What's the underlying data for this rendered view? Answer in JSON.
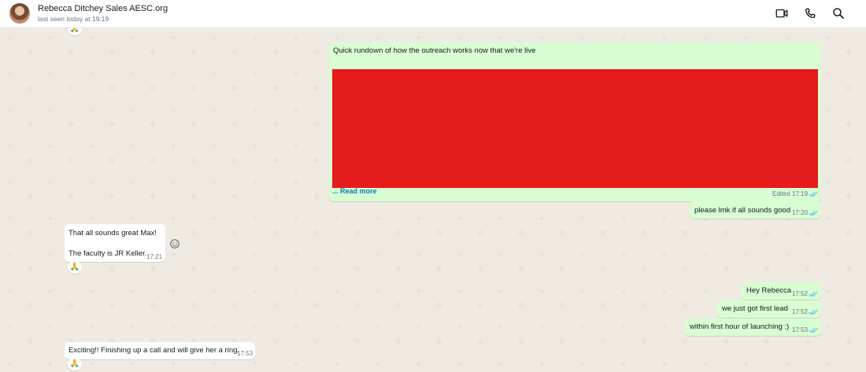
{
  "header": {
    "contact_name": "Rebecca Ditchey Sales AESC.org",
    "last_seen": "last seen today at 19:19",
    "icons": [
      "video-call-icon",
      "voice-call-icon",
      "search-icon"
    ]
  },
  "colors": {
    "outgoing_bubble": "#d9fdd3",
    "incoming_bubble": "#ffffff",
    "chat_background": "#efeae2",
    "read_ticks": "#53bdeb",
    "redaction": "#e51c1c"
  },
  "messages": [
    {
      "text": "Quick rundown of how the outreach works now that we're live",
      "read_more": "... Read more",
      "edited": "Edited",
      "time": "17:19",
      "direction": "outgoing",
      "status": "read"
    },
    {
      "text": "please lmk if all sounds good",
      "time": "17:20",
      "direction": "outgoing",
      "status": "read"
    },
    {
      "line1": "That all sounds great Max!",
      "line2": "The faculty is JR Keller.",
      "time": "17:21",
      "direction": "incoming",
      "reaction": "🙏"
    },
    {
      "text": "Hey Rebecca",
      "time": "17:52",
      "direction": "outgoing",
      "status": "read"
    },
    {
      "text": "we just got first lead",
      "time": "17:52",
      "direction": "outgoing",
      "status": "read"
    },
    {
      "text": "within first hour of launching :)",
      "time": "17:53",
      "direction": "outgoing",
      "status": "read"
    },
    {
      "text": "Exciting!! Finishing up a call and will give her a ring.",
      "time": "17:53",
      "direction": "incoming",
      "reaction": "🙏"
    }
  ],
  "top_partial_reaction": "🙏"
}
